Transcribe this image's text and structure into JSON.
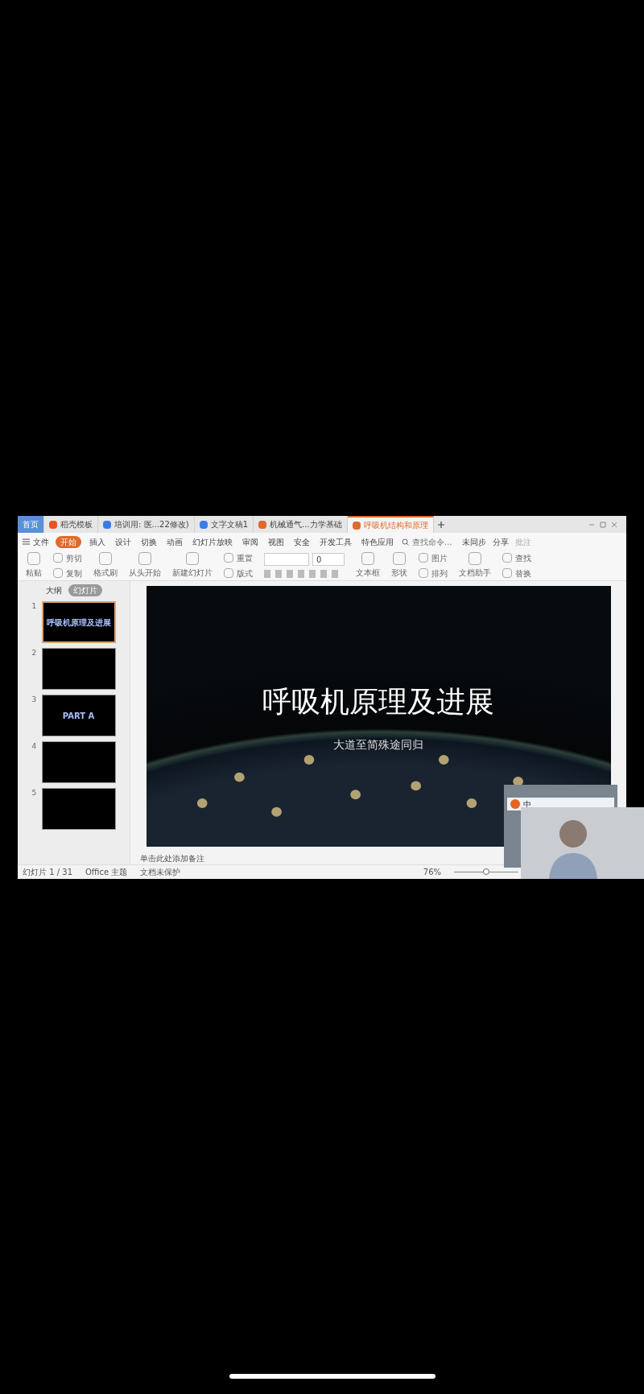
{
  "tabs": [
    {
      "label": "首页",
      "kind": "home",
      "selected": false
    },
    {
      "label": "稻壳模板",
      "kind": "template",
      "selected": false
    },
    {
      "label": "培训用: 医...22修改)",
      "kind": "writer",
      "selected": false
    },
    {
      "label": "文字文稿1",
      "kind": "writer",
      "selected": false
    },
    {
      "label": "机械通气...力学基础",
      "kind": "presentation",
      "selected": false
    },
    {
      "label": "呼吸机结构和原理",
      "kind": "presentation",
      "selected": true
    }
  ],
  "menu": {
    "file": "文件",
    "items": [
      {
        "label": "开始",
        "selected": true
      },
      {
        "label": "插入",
        "selected": false
      },
      {
        "label": "设计",
        "selected": false
      },
      {
        "label": "切换",
        "selected": false
      },
      {
        "label": "动画",
        "selected": false
      },
      {
        "label": "幻灯片放映",
        "selected": false
      },
      {
        "label": "审阅",
        "selected": false
      },
      {
        "label": "视图",
        "selected": false
      },
      {
        "label": "安全",
        "selected": false
      },
      {
        "label": "开发工具",
        "selected": false
      },
      {
        "label": "特色应用",
        "selected": false
      }
    ],
    "search": {
      "placeholder": "查找命令..."
    },
    "sync": "未同步",
    "share": "分享",
    "comment": "批注"
  },
  "ribbon": {
    "tools": [
      {
        "kind": "large",
        "label": "粘贴"
      },
      {
        "kind": "pair",
        "labels": [
          "剪切",
          "复制"
        ]
      },
      {
        "kind": "large",
        "label": "格式刷"
      },
      {
        "kind": "large",
        "label": "从头开始"
      },
      {
        "kind": "large",
        "label": "新建幻灯片"
      },
      {
        "kind": "pair",
        "labels": [
          "重置",
          "版式"
        ]
      },
      {
        "kind": "font",
        "value": "0"
      },
      {
        "kind": "large",
        "label": "文本框"
      },
      {
        "kind": "large",
        "label": "形状"
      },
      {
        "kind": "pair",
        "labels": [
          "图片",
          "排列"
        ]
      },
      {
        "kind": "large",
        "label": "文档助手"
      },
      {
        "kind": "pair",
        "labels": [
          "查找",
          "替换"
        ]
      }
    ]
  },
  "panel": {
    "views": [
      {
        "label": "大纲",
        "selected": false
      },
      {
        "label": "幻灯片",
        "selected": true
      }
    ],
    "slides": [
      {
        "number": "1",
        "selected": true,
        "caption": "呼吸机原理及进展"
      },
      {
        "number": "2",
        "selected": false
      },
      {
        "number": "3",
        "selected": false,
        "caption": "PART A"
      },
      {
        "number": "4",
        "selected": false
      },
      {
        "number": "5",
        "selected": false
      }
    ]
  },
  "slide": {
    "title": "呼吸机原理及进展",
    "subtitle": "大道至简殊途同归"
  },
  "notes": {
    "placeholder": "单击此处添加备注"
  },
  "status": {
    "slide": "幻灯片 1 / 31",
    "theme": "Office 主题",
    "protection": "文档未保护",
    "zoom": "76%",
    "zoom_slider": {
      "level": 0.5
    }
  },
  "ime": {
    "mode": "中"
  }
}
